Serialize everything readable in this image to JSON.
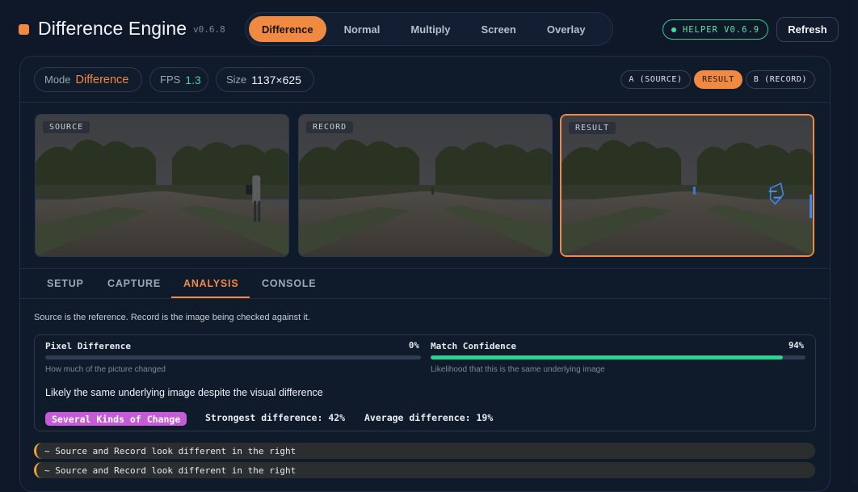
{
  "header": {
    "title": "Difference Engine",
    "version": "v0.6.8",
    "modes": [
      "Difference",
      "Normal",
      "Multiply",
      "Screen",
      "Overlay"
    ],
    "active_mode": "Difference",
    "helper_label": "HELPER V0.6.9",
    "refresh_label": "Refresh"
  },
  "stats": {
    "mode_label": "Mode",
    "mode_value": "Difference",
    "fps_label": "FPS",
    "fps_value": "1.3",
    "size_label": "Size",
    "size_value": "1137×625"
  },
  "view_buttons": [
    "A (SOURCE)",
    "RESULT",
    "B (RECORD)"
  ],
  "active_view": "RESULT",
  "images": {
    "source_label": "SOURCE",
    "record_label": "RECORD",
    "result_label": "RESULT"
  },
  "tabs": [
    "SETUP",
    "CAPTURE",
    "ANALYSIS",
    "CONSOLE"
  ],
  "active_tab": "ANALYSIS",
  "analysis": {
    "description": "Source is the reference. Record is the image being checked against it.",
    "pixel_difference": {
      "title": "Pixel Difference",
      "percent_label": "0%",
      "value": 0,
      "subtitle": "How much of the picture changed"
    },
    "match_confidence": {
      "title": "Match Confidence",
      "percent_label": "94%",
      "value": 94,
      "subtitle": "Likelihood that this is the same underlying image"
    },
    "verdict": "Likely the same underlying image despite the visual difference",
    "kind_badge": "Several Kinds of Change",
    "strongest": "Strongest difference: 42%",
    "average": "Average difference: 19%"
  },
  "log": [
    "~ Source and Record look different in the right",
    "~ Source and Record look different in the right"
  ],
  "colors": {
    "accent": "#f08a42",
    "success": "#2fd18f",
    "badge": "#c65bd8",
    "warning": "#f0a33a"
  }
}
